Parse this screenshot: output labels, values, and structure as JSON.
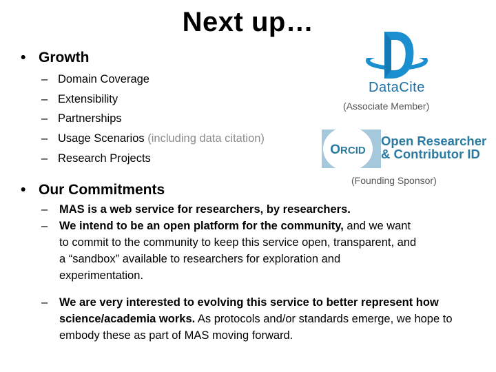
{
  "slide": {
    "title": "Next up…",
    "growth": {
      "heading": "Growth",
      "bullet": "•",
      "items": [
        {
          "text": "Domain Coverage",
          "note": ""
        },
        {
          "text": "Extensibility",
          "note": ""
        },
        {
          "text": "Partnerships",
          "note": ""
        },
        {
          "text": "Usage Scenarios",
          "note": " (including data citation)"
        },
        {
          "text": "Research Projects",
          "note": ""
        }
      ]
    },
    "commitments": {
      "heading": "Our Commitments",
      "bullet": "•",
      "items": [
        {
          "bold": "MAS is a web service for researchers, by researchers.",
          "normal": ""
        },
        {
          "bold": "We intend to be an open platform for the community,",
          "normal": " and we want to commit to the community to keep this service open, transparent, and a “sandbox” available to researchers for exploration and experimentation."
        },
        {
          "bold": "We are very interested to evolving this service to better represent how science/academia works.",
          "normal": "  As protocols and/or standards emerge, we hope to embody these as part of MAS moving forward."
        }
      ]
    },
    "dash": "–"
  },
  "logos": {
    "datacite": {
      "icon": "datacite-logo-icon",
      "name_part1": "Data",
      "name_part2": "Cite",
      "caption": "(Associate Member)",
      "color": "#1a8fd0",
      "text_color": "#1b6fa6"
    },
    "orcid": {
      "icon": "orcid-logo-icon",
      "mark": "ORCID",
      "line1": "Open Researcher",
      "line2": "& Contributor ID",
      "caption": "(Founding Sponsor)",
      "ring_color": "#a6c8dc",
      "text_color": "#2a7aa1"
    }
  }
}
